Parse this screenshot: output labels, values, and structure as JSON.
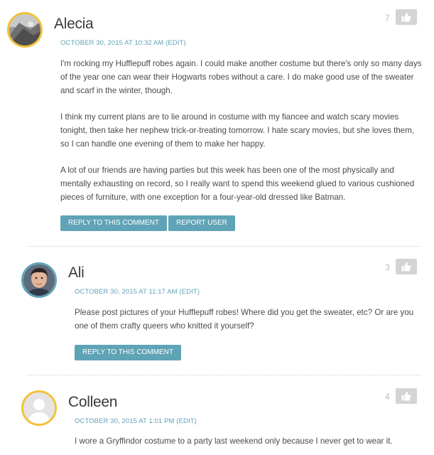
{
  "comments": [
    {
      "author": "Alecia",
      "date": "OCTOBER 30, 2015 AT 10:32 AM",
      "edit": "(EDIT)",
      "votes": "7",
      "paragraphs": [
        "I'm rocking my Hufflepuff robes again. I could make another costume but there's only so many days of the year one can wear their Hogwarts robes without a care. I do make good use of the sweater and scarf in the winter, though.",
        "I think my current plans are to lie around in costume with my fiancee and watch scary movies tonight, then take her nephew trick-or-treating tomorrow. I hate scary movies, but she loves them, so I can handle one evening of them to make her happy.",
        "A lot of our friends are having parties but this week has been one of the most physically and mentally exhausting on record, so I really want to spend this weekend glued to various cushioned pieces of furniture, with one exception for a four-year-old dressed like Batman."
      ],
      "reply_label": "REPLY TO THIS COMMENT",
      "report_label": "REPORT USER"
    },
    {
      "author": "Ali",
      "date": "OCTOBER 30, 2015 AT 11:17 AM",
      "edit": "(EDIT)",
      "votes": "3",
      "paragraphs": [
        "Please post pictures of your Hufflepuff robes! Where did you get the sweater, etc? Or are you one of them crafty queers who knitted it yourself?"
      ],
      "reply_label": "REPLY TO THIS COMMENT"
    },
    {
      "author": "Colleen",
      "date": "OCTOBER 30, 2015 AT 1:01 PM",
      "edit": "(EDIT)",
      "votes": "4",
      "paragraphs": [
        "I wore a Gryffindor costume to a party last weekend only because I never get to wear it."
      ]
    }
  ],
  "colors": {
    "accent": "#5fa3b6",
    "avatar_ring": "#f3c23b",
    "like_button": "#d4d4d4"
  },
  "icons": {
    "like": "thumbs-up-icon"
  }
}
